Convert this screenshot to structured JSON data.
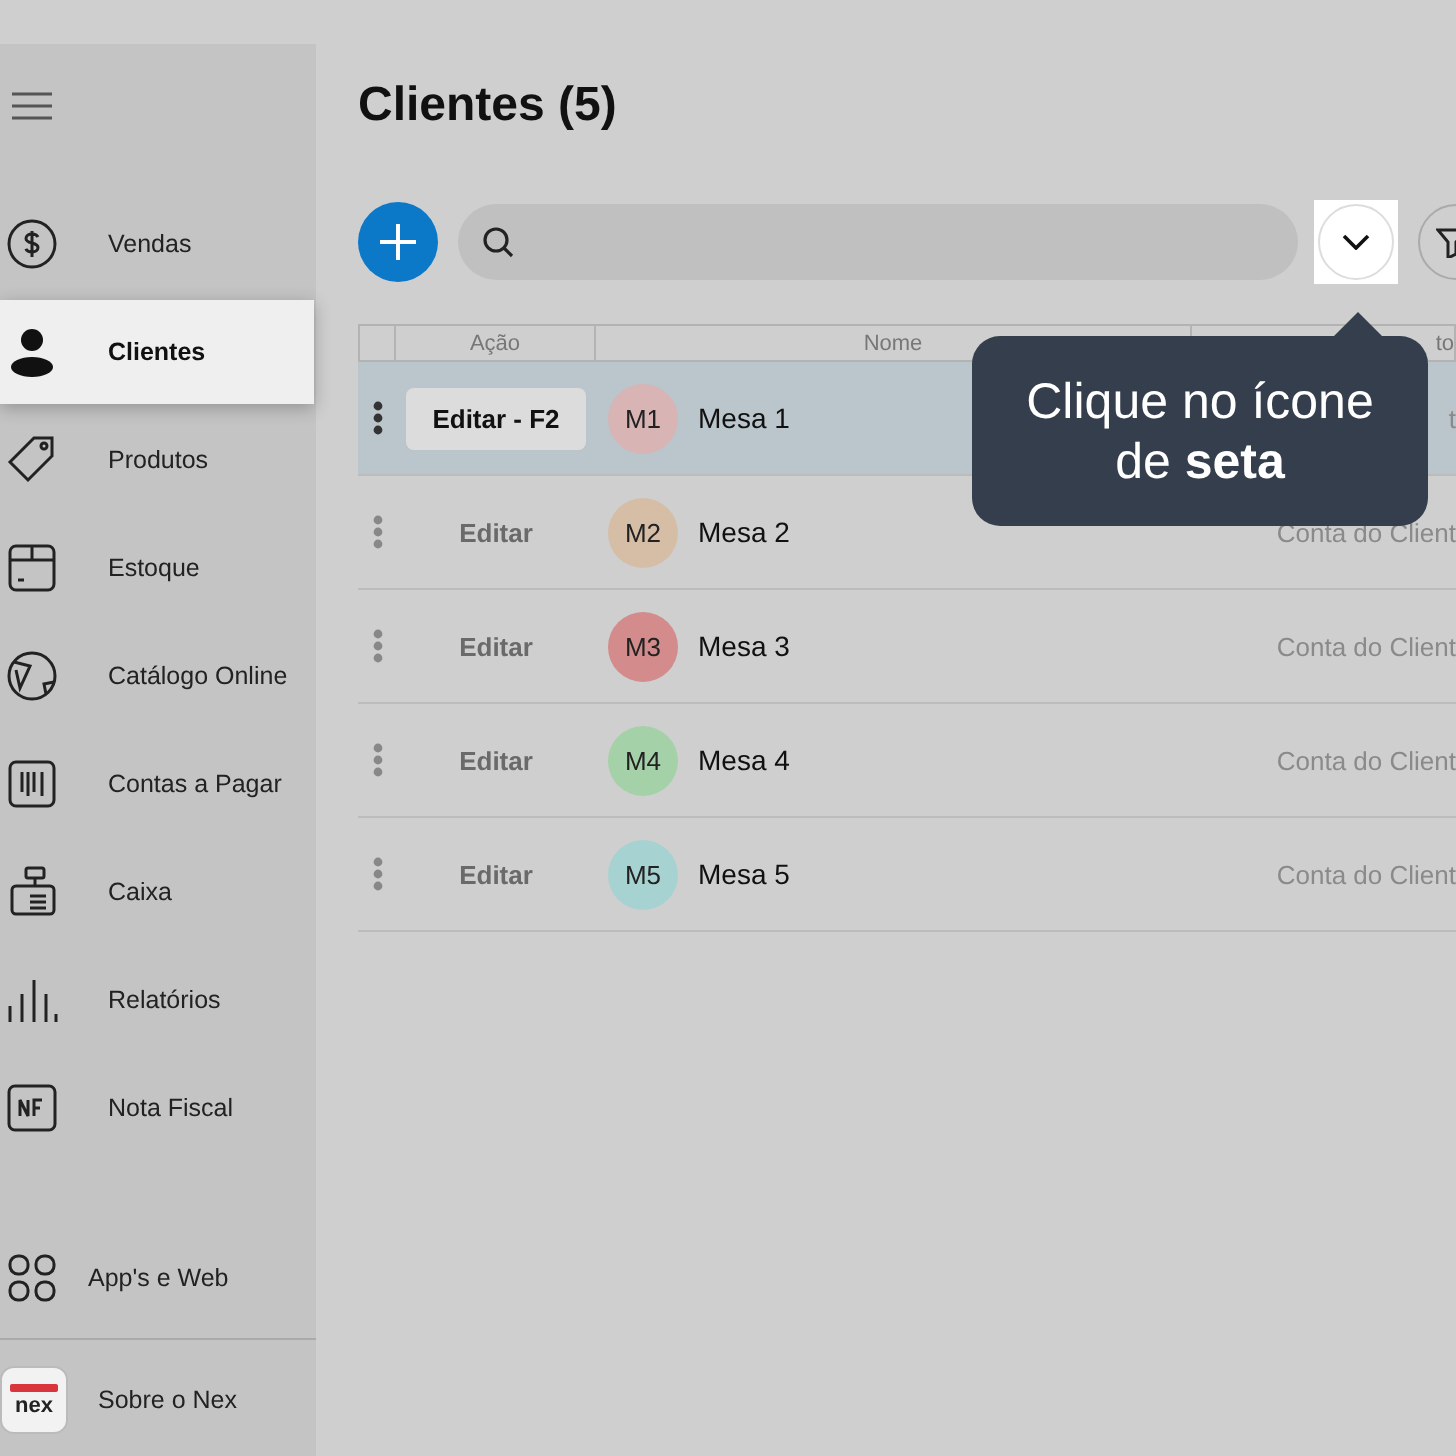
{
  "sidebar": {
    "items": [
      {
        "kind": "money",
        "label": "Vendas",
        "selected": false
      },
      {
        "kind": "person",
        "label": "Clientes",
        "selected": true
      },
      {
        "kind": "tag",
        "label": "Produtos",
        "selected": false
      },
      {
        "kind": "box",
        "label": "Estoque",
        "selected": false
      },
      {
        "kind": "globe",
        "label": "Catálogo Online",
        "selected": false
      },
      {
        "kind": "bill",
        "label": "Contas a Pagar",
        "selected": false
      },
      {
        "kind": "register",
        "label": "Caixa",
        "selected": false
      },
      {
        "kind": "bars",
        "label": "Relatórios",
        "selected": false
      },
      {
        "kind": "nf",
        "label": "Nota Fiscal",
        "selected": false
      }
    ],
    "bottom_items": [
      {
        "kind": "apps",
        "label": "App's e Web"
      },
      {
        "kind": "logo",
        "label": "Sobre o Nex",
        "logo_text": "nex"
      }
    ]
  },
  "title": "Clientes (5)",
  "table": {
    "columns": [
      "Ação",
      "Nome",
      "to"
    ],
    "rows": [
      {
        "selected": true,
        "action": "Editar - F2",
        "initials": "M1",
        "color": "#d8b4b4",
        "name": "Mesa 1",
        "column_3": "t"
      },
      {
        "selected": false,
        "action": "Editar",
        "initials": "M2",
        "color": "#d6bea6",
        "name": "Mesa 2",
        "column_3": "Conta do Client"
      },
      {
        "selected": false,
        "action": "Editar",
        "initials": "M3",
        "color": "#d38b8b",
        "name": "Mesa 3",
        "column_3": "Conta do Client"
      },
      {
        "selected": false,
        "action": "Editar",
        "initials": "M4",
        "color": "#a5d1a8",
        "name": "Mesa 4",
        "column_3": "Conta do Client"
      },
      {
        "selected": false,
        "action": "Editar",
        "initials": "M5",
        "color": "#a6d3d1",
        "name": "Mesa 5",
        "column_3": "Conta do Client"
      }
    ]
  },
  "tooltip": {
    "text": "Clique no ícone de **seta**"
  }
}
